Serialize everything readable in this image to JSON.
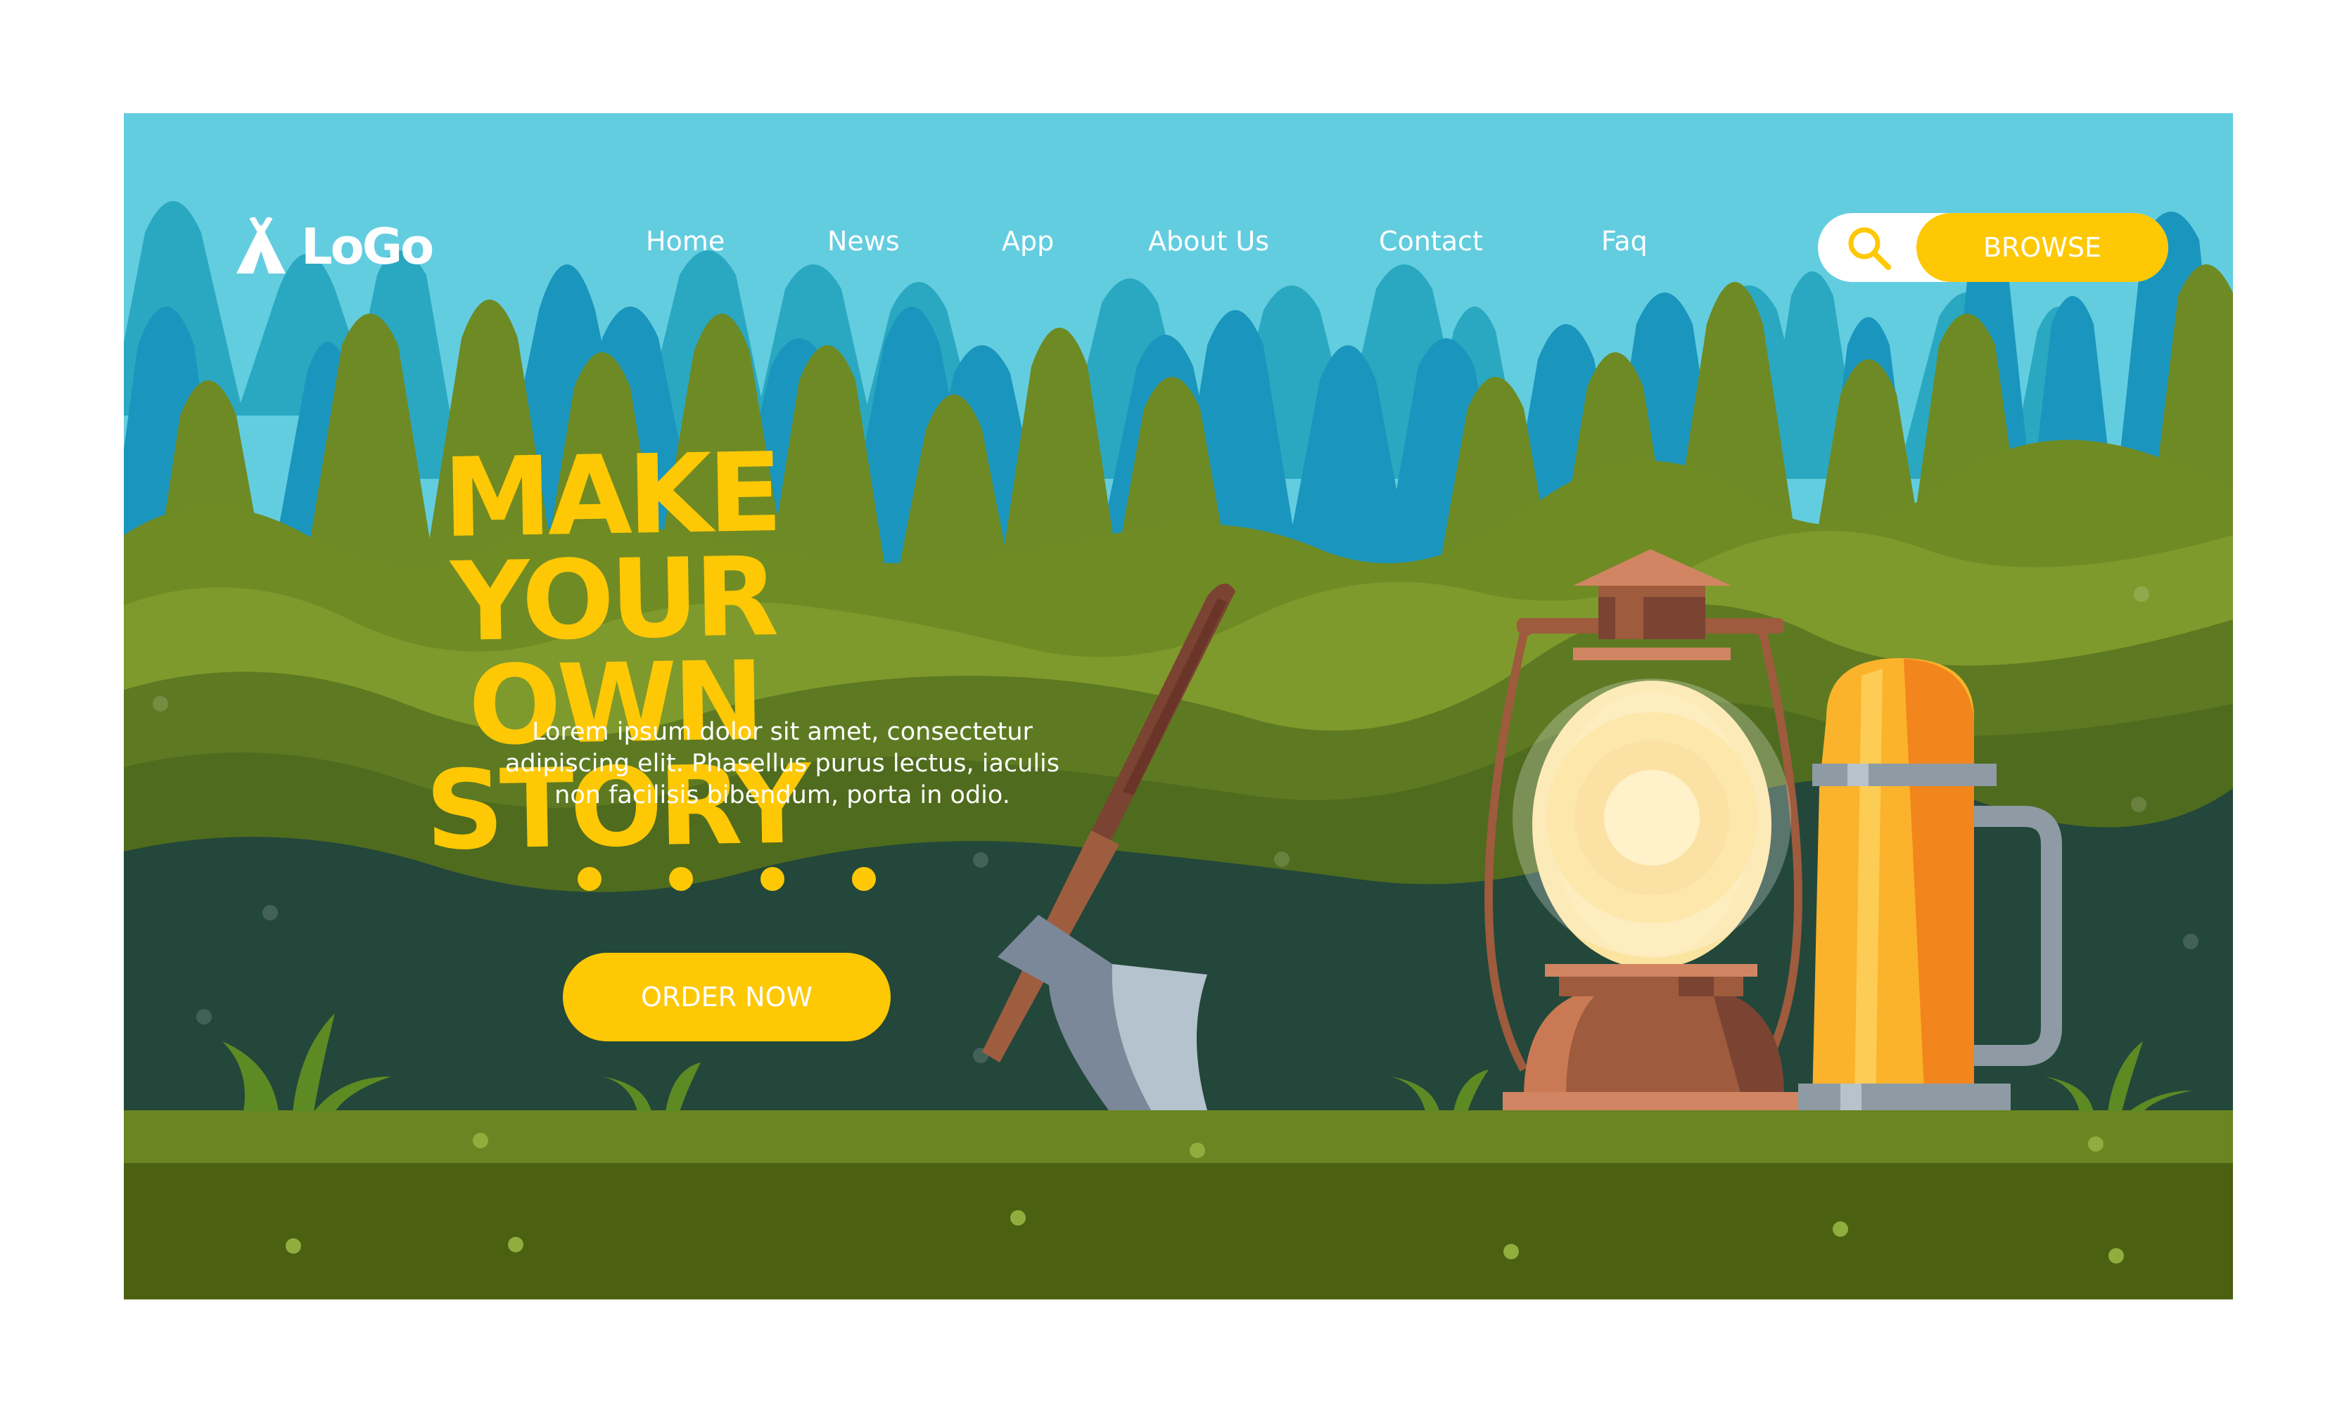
{
  "logo": {
    "text": "LoGo",
    "icon": "tent-icon"
  },
  "nav": {
    "items": [
      "Home",
      "News",
      "App",
      "About Us",
      "Contact",
      "Faq"
    ]
  },
  "search": {
    "icon": "search-icon"
  },
  "browse": {
    "label": "BROWSE"
  },
  "hero": {
    "title_line1": "MAKE YOUR",
    "title_line2": "OWN STORY",
    "description_line1": "Lorem ipsum dolor sit amet, consectetur",
    "description_line2": "adipiscing elit. Phasellus purus lectus, iaculis",
    "description_line3": "non facilisis bibendum, porta in odio."
  },
  "slider": {
    "dot_count": 4
  },
  "order": {
    "label": "ORDER NOW"
  },
  "colors": {
    "sky": "#63cde0",
    "accent_yellow": "#fec805",
    "forest_green": "#6f8b24",
    "dark_green": "#23473a",
    "ground": "#4b6010",
    "lantern_copper": "#9e5b3d",
    "thermos_orange": "#fbb32b"
  }
}
